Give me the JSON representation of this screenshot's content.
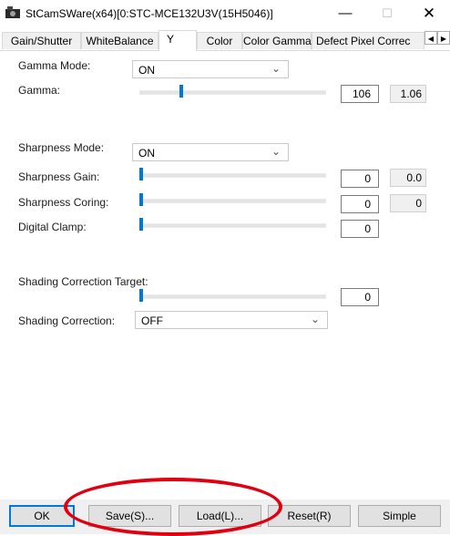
{
  "window": {
    "title": "StCamSWare(x64)[0:STC-MCE132U3V(15H5046)]",
    "min_glyph": "—",
    "max_glyph": "☐",
    "close_glyph": "✕"
  },
  "tabs": [
    {
      "label": "Gain/Shutter",
      "active": false
    },
    {
      "label": "WhiteBalance",
      "active": false
    },
    {
      "label": "Y",
      "active": true
    },
    {
      "label": "Color",
      "active": false
    },
    {
      "label": "Color Gamma",
      "active": false
    },
    {
      "label": "Defect Pixel Correc",
      "active": false
    }
  ],
  "tab_scroll": {
    "left": "◀",
    "right": "▶"
  },
  "y_panel": {
    "gamma_mode": {
      "label": "Gamma Mode:",
      "value": "ON"
    },
    "gamma": {
      "label": "Gamma:",
      "value": "106",
      "readout": "1.06"
    },
    "sharpness_mode": {
      "label": "Sharpness Mode:",
      "value": "ON"
    },
    "sharpness_gain": {
      "label": "Sharpness Gain:",
      "value": "0",
      "readout": "0.0"
    },
    "sharpness_coring": {
      "label": "Sharpness Coring:",
      "value": "0",
      "readout": "0"
    },
    "digital_clamp": {
      "label": "Digital Clamp:",
      "value": "0"
    },
    "shading_target": {
      "label": "Shading Correction Target:",
      "value": "0"
    },
    "shading_correction": {
      "label": "Shading Correction:",
      "value": "OFF"
    }
  },
  "buttons": {
    "ok": "OK",
    "save": "Save(S)...",
    "load": "Load(L)...",
    "reset": "Reset(R)",
    "simple": "Simple"
  },
  "icons": {
    "chevron": "⌄",
    "app": "camera-app-icon"
  },
  "colors": {
    "accent": "#0078d7",
    "annotation": "#e00010"
  }
}
